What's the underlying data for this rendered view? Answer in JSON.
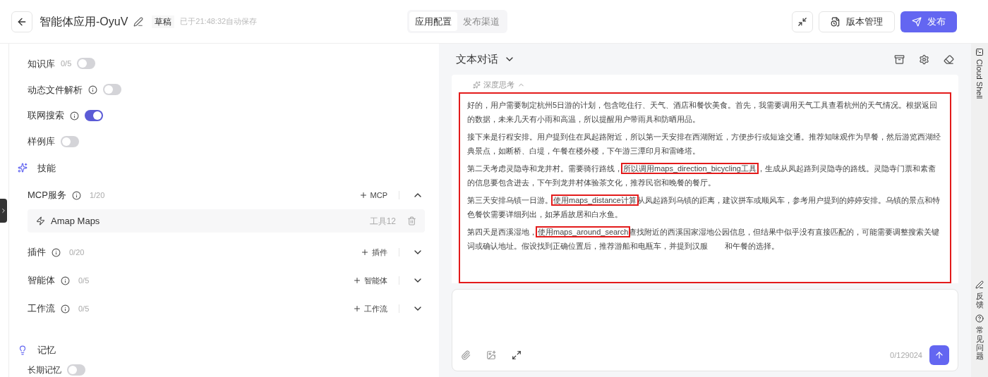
{
  "header": {
    "title": "智能体应用-OyuV",
    "status": "草稿",
    "saved": "已于21:48:32自动保存",
    "tabs": [
      {
        "label": "应用配置",
        "selected": true
      },
      {
        "label": "发布渠道",
        "selected": false
      }
    ],
    "version_button": "版本管理",
    "publish_button": "发布"
  },
  "left": {
    "toggles": [
      {
        "label": "知识库",
        "count": "0/5",
        "info": false,
        "on": false
      },
      {
        "label": "动态文件解析",
        "info": true,
        "on": false
      },
      {
        "label": "联网搜索",
        "info": true,
        "on": true
      },
      {
        "label": "样例库",
        "info": false,
        "on": false
      }
    ],
    "skills_title": "技能",
    "groups": [
      {
        "label": "MCP服务",
        "count": "1/20",
        "add": "MCP",
        "expanded": true,
        "items": [
          {
            "name": "Amap Maps",
            "tools": "工具12"
          }
        ]
      },
      {
        "label": "插件",
        "count": "0/20",
        "add": "插件",
        "expanded": false
      },
      {
        "label": "智能体",
        "count": "0/5",
        "add": "智能体",
        "expanded": false
      },
      {
        "label": "工作流",
        "count": "0/5",
        "add": "工作流",
        "expanded": false
      }
    ],
    "memory_title": "记忆",
    "memory_toggle": {
      "label": "长期记忆",
      "on": false
    }
  },
  "chat": {
    "mode": "文本对话",
    "thinking": "深度思考",
    "paragraphs": [
      [
        {
          "text": "好的，用户需要制定杭州5日游的计划，包含吃住行、天气、酒店和餐饮美食。首先，我需要调用天气工具查看杭州的天气情况。根据返回的数据，未来几天有小雨和高温，所以提醒用户带雨具和防晒用品。",
          "boxed": false
        }
      ],
      [
        {
          "text": "接下来是行程安排。用户提到住在凤起路附近，所以第一天安排在西湖附近，方便步行或短途交通。推荐知味观作为早餐，然后游览西湖经典景点，如断桥、白堤，午餐在楼外楼，下午游三潭印月和雷峰塔。",
          "boxed": false
        }
      ],
      [
        {
          "text": "第二天考虑灵隐寺和龙井村。需要骑行路线，",
          "boxed": false
        },
        {
          "text": "所以调用maps_direction_bicycling工具",
          "boxed": true
        },
        {
          "text": "，生成从凤起路到灵隐寺的路线。灵隐寺门票和素斋的信息要包含进去，下午到龙井村体验茶文化，推荐民宿和晚餐的餐厅。",
          "boxed": false
        }
      ],
      [
        {
          "text": "第三天安排乌镇一日游。",
          "boxed": false
        },
        {
          "text": "使用maps_distance计算",
          "boxed": true
        },
        {
          "text": "从凤起路到乌镇的距离，建议拼车或顺风车，参考用户提到的婷婷安排。乌镇的景点和特色餐饮需要详细列出，如茅盾故居和白水鱼。",
          "boxed": false
        }
      ],
      [
        {
          "text": "第四天是西溪湿地，",
          "boxed": false
        },
        {
          "text": "使用maps_around_search",
          "boxed": true
        },
        {
          "text": "查找附近的西溪国家湿地公园信息，但结果中似乎没有直接匹配的，可能需要调整搜索关键词或确认地址。假设找到正确位置后，推荐游船和电瓶车，并提到汉服",
          "boxed": false
        },
        {
          "text": "和午餐的选择。",
          "boxed": false
        }
      ]
    ],
    "counter": "0/129024"
  },
  "side": [
    {
      "label": "Cloud Shell",
      "kind": "latin"
    },
    {
      "label": "反馈",
      "kind": "cjk"
    },
    {
      "label": "常见问题",
      "kind": "cjk"
    }
  ]
}
